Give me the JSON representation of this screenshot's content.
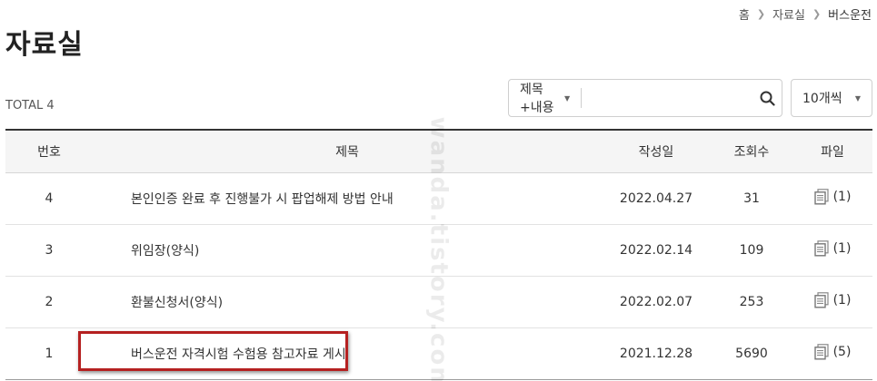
{
  "breadcrumb": {
    "home": "홈",
    "section": "자료실",
    "current": "버스운전"
  },
  "page_title": "자료실",
  "total": {
    "label": "TOTAL",
    "count": "4"
  },
  "search": {
    "scope": "제목+내용",
    "query": ""
  },
  "per_page": {
    "selected": "10개씩"
  },
  "table": {
    "columns": {
      "no": "번호",
      "title": "제목",
      "date": "작성일",
      "views": "조회수",
      "file": "파일"
    },
    "rows": [
      {
        "no": "4",
        "title": "본인인증 완료 후 진행불가 시 팝업해제 방법 안내",
        "date": "2022.04.27",
        "views": "31",
        "files": "(1)"
      },
      {
        "no": "3",
        "title": "위임장(양식)",
        "date": "2022.02.14",
        "views": "109",
        "files": "(1)"
      },
      {
        "no": "2",
        "title": "환불신청서(양식)",
        "date": "2022.02.07",
        "views": "253",
        "files": "(1)"
      },
      {
        "no": "1",
        "title": "버스운전 자격시험 수험용 참고자료 게시",
        "date": "2021.12.28",
        "views": "5690",
        "files": "(5)"
      }
    ]
  },
  "icons": {
    "search": "search-icon",
    "file": "file-icon",
    "caret": "caret-down-icon"
  },
  "colors": {
    "highlight": "#b52020",
    "header_bg": "#f5f5f5",
    "header_border": "#333333"
  },
  "watermark": "wanda.tistory.com"
}
